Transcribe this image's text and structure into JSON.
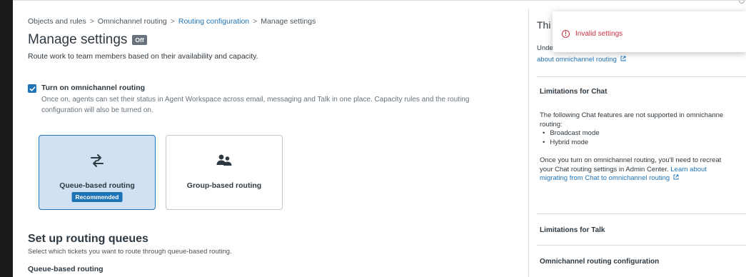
{
  "breadcrumb": {
    "items": [
      "Objects and rules",
      "Omnichannel routing",
      "Routing configuration",
      "Manage settings"
    ],
    "separator": ">"
  },
  "page": {
    "title": "Manage settings",
    "status_badge": "Off",
    "subtitle": "Route work to team members based on their availability and capacity."
  },
  "omnichannel": {
    "checked": true,
    "label": "Turn on omnichannel routing",
    "hint": "Once on, agents can set their status in Agent Workspace across email, messaging and Talk in one place. Capacity rules and the routing configuration will also be turned on."
  },
  "routing_options": [
    {
      "label": "Queue-based routing",
      "badge": "Recommended",
      "selected": true,
      "icon": "routing-arrows-icon"
    },
    {
      "label": "Group-based routing",
      "badge": "",
      "selected": false,
      "icon": "group-users-icon"
    }
  ],
  "queues": {
    "title": "Set up routing queues",
    "subtitle": "Select which tickets you want to route through queue-based routing.",
    "label": "Queue-based routing"
  },
  "panel": {
    "title": "Thi",
    "intro": "Unde",
    "link": "about omnichannel routing",
    "sections": [
      {
        "title": "Limitations for Chat",
        "body": "The following Chat features are not supported in omnichanne",
        "body2": "routing:",
        "bullets": [
          "Broadcast mode",
          "Hybrid mode"
        ],
        "note1": "Once you turn on omnichannel routing, you'll need to recreat",
        "note2": "your Chat routing settings in Admin Center.",
        "note_link1": "Learn about",
        "note_link2": "migrating from Chat to omnichannel routing"
      },
      {
        "title": "Limitations for Talk"
      },
      {
        "title": "Omnichannel routing configuration"
      }
    ]
  },
  "toast": {
    "message": "Invalid settings",
    "icon_glyph": "!"
  },
  "colors": {
    "accent": "#1f73b7",
    "selected_tile": "#cfe1f2",
    "error": "#cc3340",
    "badge_off": "#68737d"
  }
}
